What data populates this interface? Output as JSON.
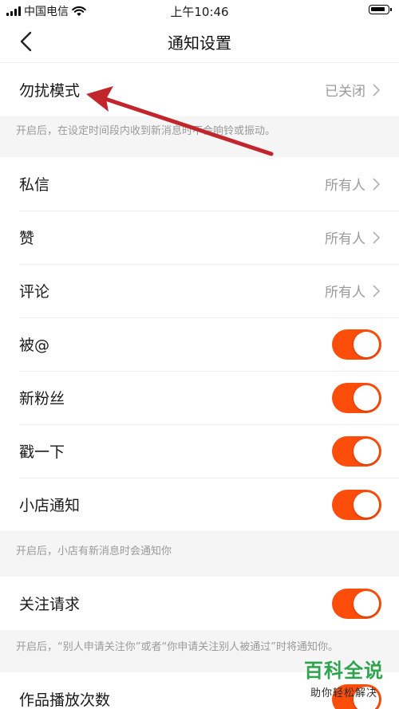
{
  "status_bar": {
    "carrier": "中国电信",
    "time": "上午10:46"
  },
  "nav": {
    "title": "通知设置"
  },
  "dnd": {
    "label": "勿扰模式",
    "value": "已关闭",
    "note": "开启后，在设定时间段内收到新消息时不会响铃或振动。"
  },
  "rows": [
    {
      "label": "私信",
      "value": "所有人"
    },
    {
      "label": "赞",
      "value": "所有人"
    },
    {
      "label": "评论",
      "value": "所有人"
    },
    {
      "label": "被@",
      "toggle": "on"
    },
    {
      "label": "新粉丝",
      "toggle": "on"
    },
    {
      "label": "戳一下",
      "toggle": "on"
    },
    {
      "label": "小店通知",
      "toggle": "on"
    }
  ],
  "shop_note": "开启后，小店有新消息时会通知你",
  "follow": {
    "label": "关注请求",
    "toggle": "on",
    "note": "开启后，“别人申请关注你”或者“你申请关注别人被通过”时将通知你。"
  },
  "plays": {
    "label": "作品播放次数"
  },
  "watermark": {
    "title": "百科全说",
    "subtitle": "助你轻松解决"
  },
  "colors": {
    "toggle_on": "#fd4d0b",
    "arrow": "#c0262c",
    "watermark": "#2ea44f"
  }
}
